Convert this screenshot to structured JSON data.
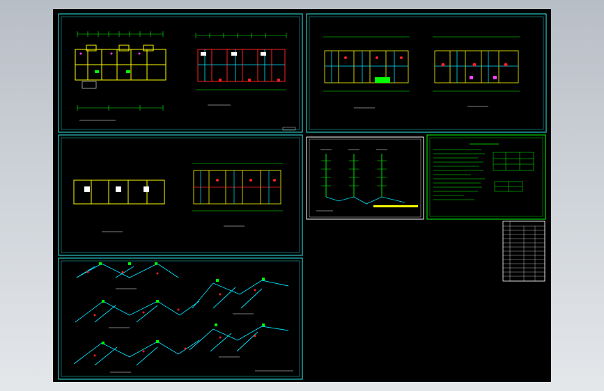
{
  "app": {
    "canvas_background": "#000000",
    "page_background": "#c8cdd3"
  },
  "colors": {
    "frame": "#2ac7c7",
    "wall": "#ffff00",
    "pipe_cyan": "#00e5ff",
    "pipe_red": "#ff2020",
    "pipe_green": "#00ff00",
    "pipe_magenta": "#ff40ff",
    "text_white": "#ffffff"
  },
  "sheets": [
    {
      "id": "sheet-1",
      "content": "floor-plans"
    },
    {
      "id": "sheet-2",
      "content": "floor-plans"
    },
    {
      "id": "sheet-3",
      "content": "floor-plans"
    },
    {
      "id": "sheet-4",
      "content": "isometric-drawings"
    },
    {
      "id": "sheet-5",
      "content": "riser-diagram"
    },
    {
      "id": "sheet-6",
      "content": "notes-and-tables"
    }
  ]
}
